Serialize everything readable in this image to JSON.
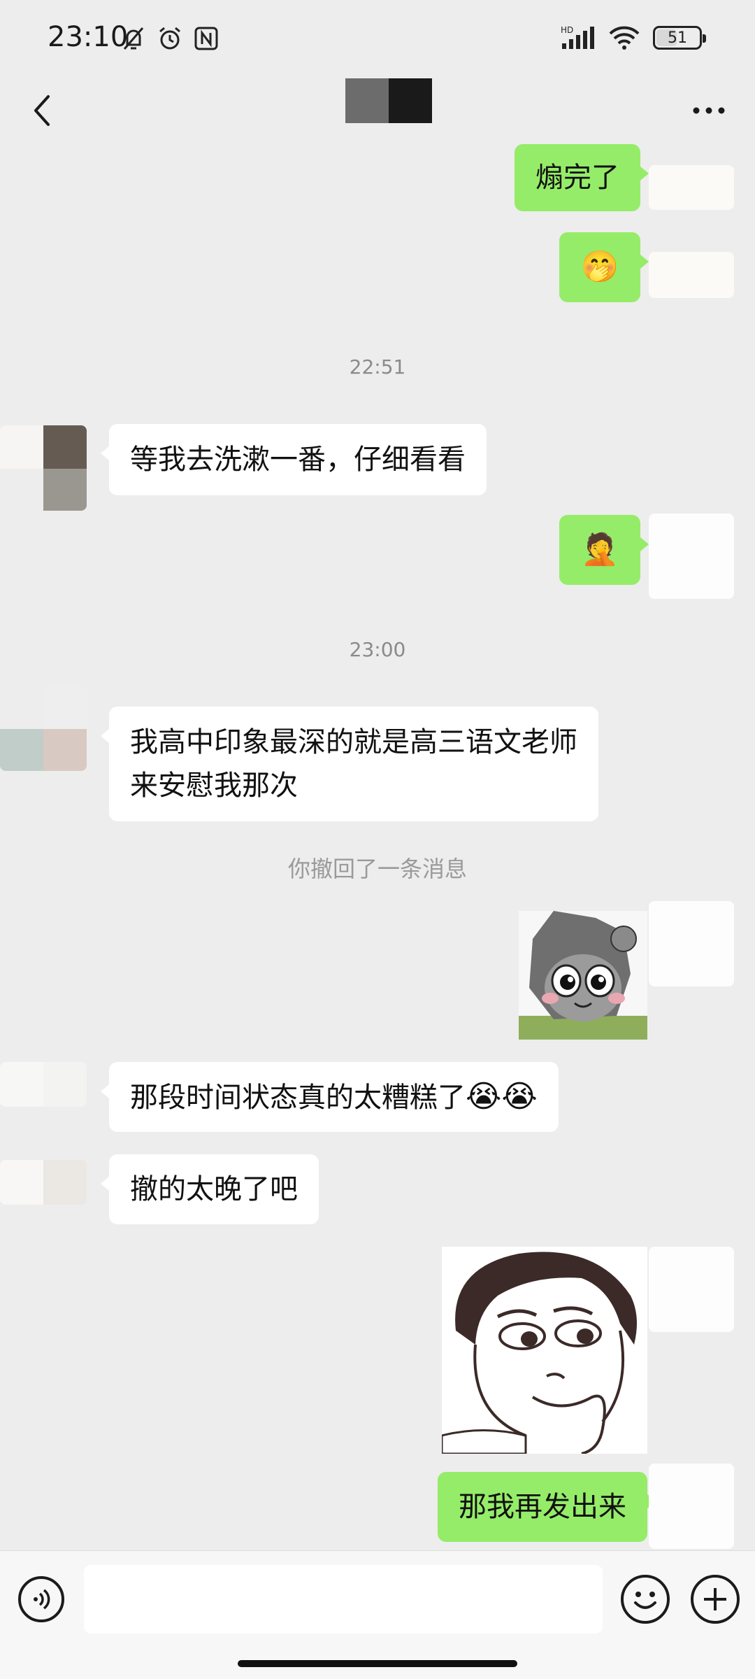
{
  "status_bar": {
    "time": "23:10",
    "network": "HD",
    "battery": "51",
    "battery_level_percent": 51
  },
  "header": {
    "back_icon": "chevron-left-icon",
    "more_icon": "ellipsis-icon"
  },
  "messages": [
    {
      "from": "me",
      "text": "煽完了"
    },
    {
      "from": "me",
      "emoji": "🤭"
    },
    {
      "type": "timestamp",
      "text": "22:51"
    },
    {
      "from": "them",
      "text": "等我去洗漱一番，仔细看看"
    },
    {
      "from": "me",
      "emoji": "🤦"
    },
    {
      "type": "timestamp",
      "text": "23:00"
    },
    {
      "from": "them",
      "text": "我高中印象最深的就是高三语文老师来安慰我那次",
      "line1": "我高中印象最深的就是高三语文老师",
      "line2": "来安慰我那次"
    },
    {
      "type": "system",
      "text": "你撤回了一条消息"
    },
    {
      "from": "me",
      "sticker": "grey-wolf-cartoon-sticker"
    },
    {
      "from": "them",
      "text": "那段时间状态真的太糟糕了",
      "emoji": "😭😭"
    },
    {
      "from": "them",
      "text": "撤的太晚了吧"
    },
    {
      "from": "me",
      "sticker": "pondering-girl-sketch-sticker"
    },
    {
      "from": "me",
      "text": "那我再发出来"
    }
  ],
  "input_bar": {
    "voice_icon": "voice-icon",
    "emoji_icon": "smile-icon",
    "plus_icon": "plus-icon",
    "placeholder": ""
  },
  "colors": {
    "background": "#ededed",
    "my_bubble": "#95ec69",
    "their_bubble": "#ffffff"
  }
}
